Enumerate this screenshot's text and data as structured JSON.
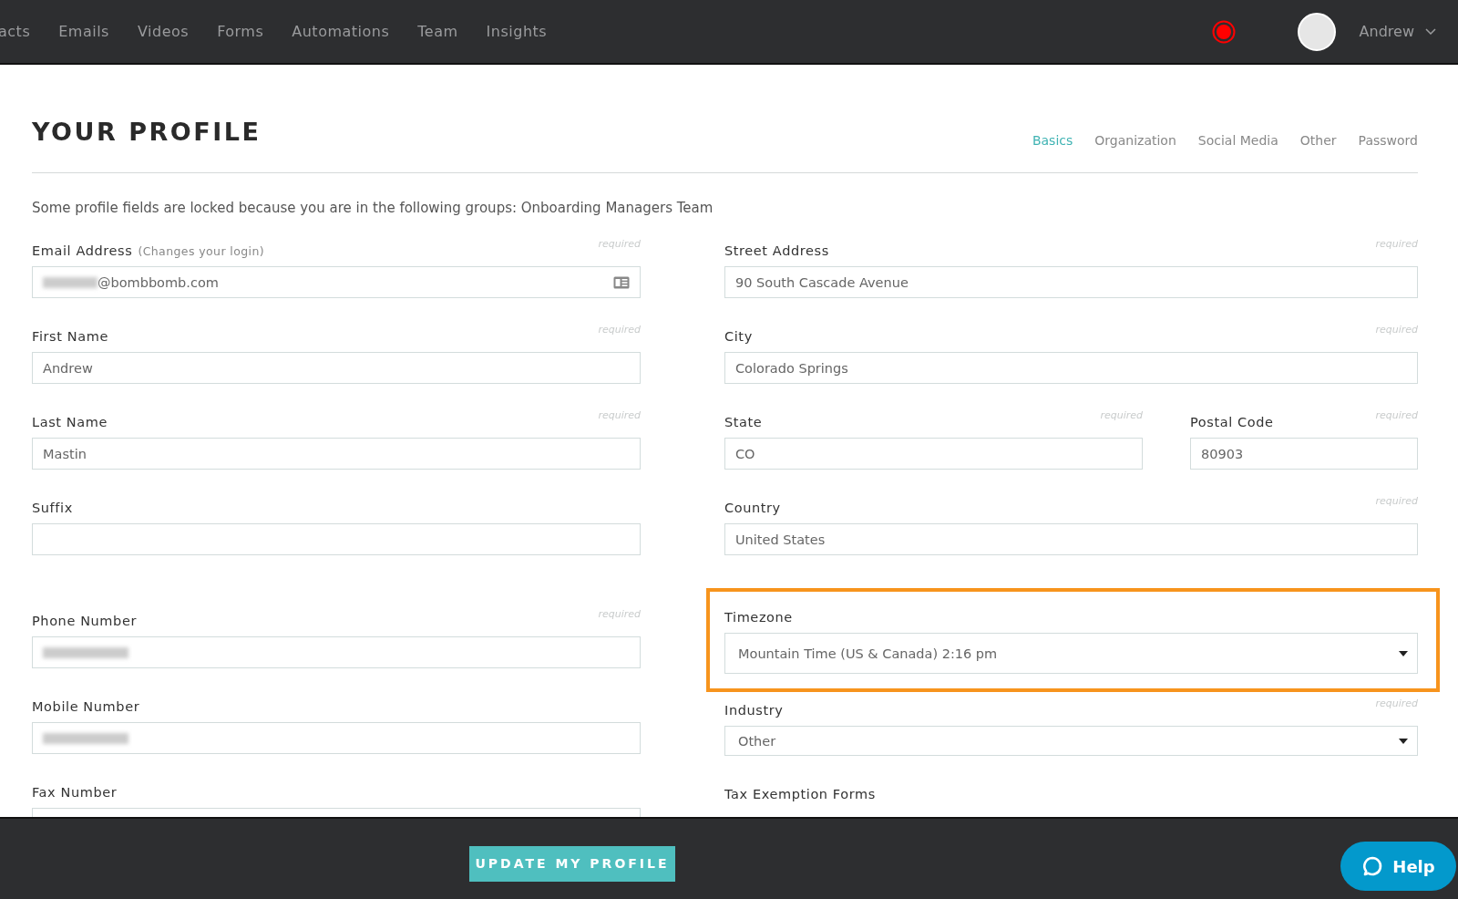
{
  "nav": {
    "items": [
      "acts",
      "Emails",
      "Videos",
      "Forms",
      "Automations",
      "Team",
      "Insights"
    ],
    "user": "Andrew"
  },
  "title": "YOUR PROFILE",
  "tabs": [
    {
      "label": "Basics",
      "selected": true
    },
    {
      "label": "Organization",
      "selected": false
    },
    {
      "label": "Social Media",
      "selected": false
    },
    {
      "label": "Other",
      "selected": false
    },
    {
      "label": "Password",
      "selected": false
    }
  ],
  "notice": "Some profile fields are locked because you are in the following groups: Onboarding Managers Team",
  "form": {
    "left": [
      [
        {
          "kind": "text",
          "label": "Email Address",
          "note": "(Changes your login)",
          "hint": "required",
          "value": "@bombbomb.com",
          "redacted": true,
          "card_icon": true
        },
        {
          "kind": "text",
          "label": "First Name",
          "hint": "required",
          "value": "Andrew"
        },
        {
          "kind": "text",
          "label": "Last Name",
          "hint": "required",
          "value": "Mastin"
        },
        {
          "kind": "text",
          "label": "Suffix"
        }
      ],
      [
        {
          "kind": "text",
          "label": "Phone Number",
          "hint": "required",
          "redacted": true
        },
        {
          "kind": "text",
          "label": "Mobile Number",
          "redacted": true
        },
        {
          "kind": "text",
          "label": "Fax Number"
        }
      ]
    ],
    "right": [
      [
        {
          "kind": "text",
          "label": "Street Address",
          "hint": "required",
          "value": "90 South Cascade Avenue"
        },
        {
          "kind": "text",
          "label": "City",
          "hint": "required",
          "value": "Colorado Springs"
        },
        {
          "kind": "pair",
          "items": [
            {
              "kind": "text",
              "label": "State",
              "hint": "required",
              "value": "CO"
            },
            {
              "kind": "text",
              "label": "Postal Code",
              "hint": "required",
              "value": "80903"
            }
          ]
        },
        {
          "kind": "text",
          "label": "Country",
          "hint": "required",
          "value": "United States"
        }
      ],
      [
        {
          "kind": "select",
          "label": "Timezone",
          "value": "Mountain Time (US & Canada) 2:16 pm",
          "highlighted": true
        },
        {
          "kind": "select",
          "label": "Industry",
          "hint": "required",
          "value": "Other",
          "highlighted": false
        },
        {
          "kind": "label",
          "label": "Tax Exemption Forms"
        }
      ]
    ]
  },
  "submit": "UPDATE MY PROFILE",
  "help": "Help"
}
